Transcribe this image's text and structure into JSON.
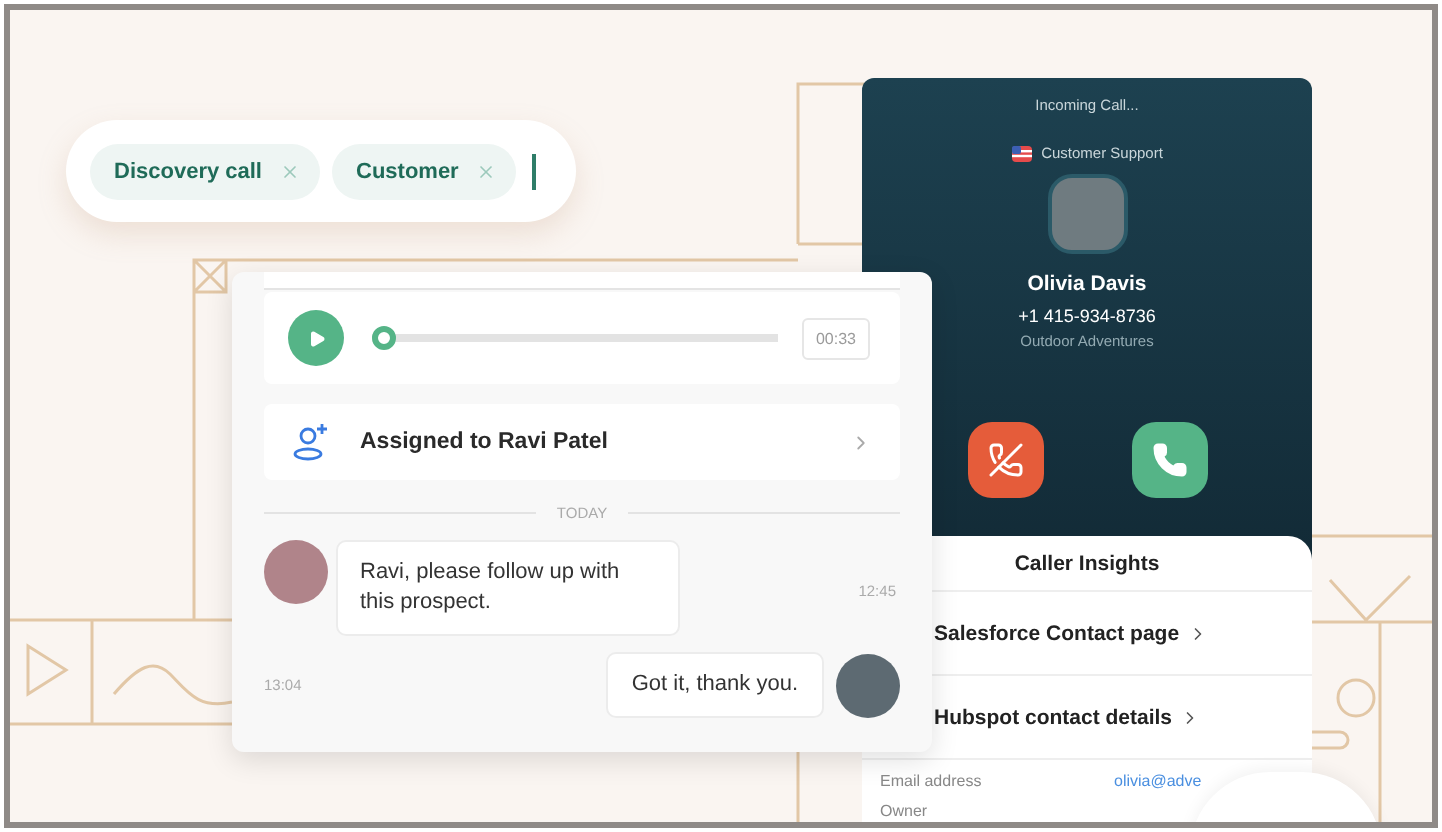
{
  "tag_input": {
    "tags": [
      {
        "label": "Discovery call"
      },
      {
        "label": "Customer"
      }
    ]
  },
  "chat_card": {
    "audio": {
      "level": 0,
      "duration": "00:33"
    },
    "assignment": "Assigned to Ravi Patel",
    "divider": "TODAY",
    "messages": [
      {
        "kind": "incoming",
        "text": "Ravi, please follow up with this prospect.",
        "time": "12:45"
      },
      {
        "kind": "outgoing",
        "text": "Got it, thank you.",
        "time": "13:04"
      }
    ]
  },
  "incoming_call": {
    "status": "Incoming Call...",
    "line": "Customer Support",
    "name": "Olivia Davis",
    "phone": "+1 415-934-8736",
    "company": "Outdoor Adventures"
  },
  "caller_insights": {
    "title": "Caller Insights",
    "links": [
      {
        "label": "Salesforce Contact page"
      },
      {
        "label": "Hubspot contact details"
      }
    ],
    "fields": [
      {
        "label": "Email address",
        "value": "olivia@adve"
      },
      {
        "label": "Owner"
      }
    ]
  }
}
